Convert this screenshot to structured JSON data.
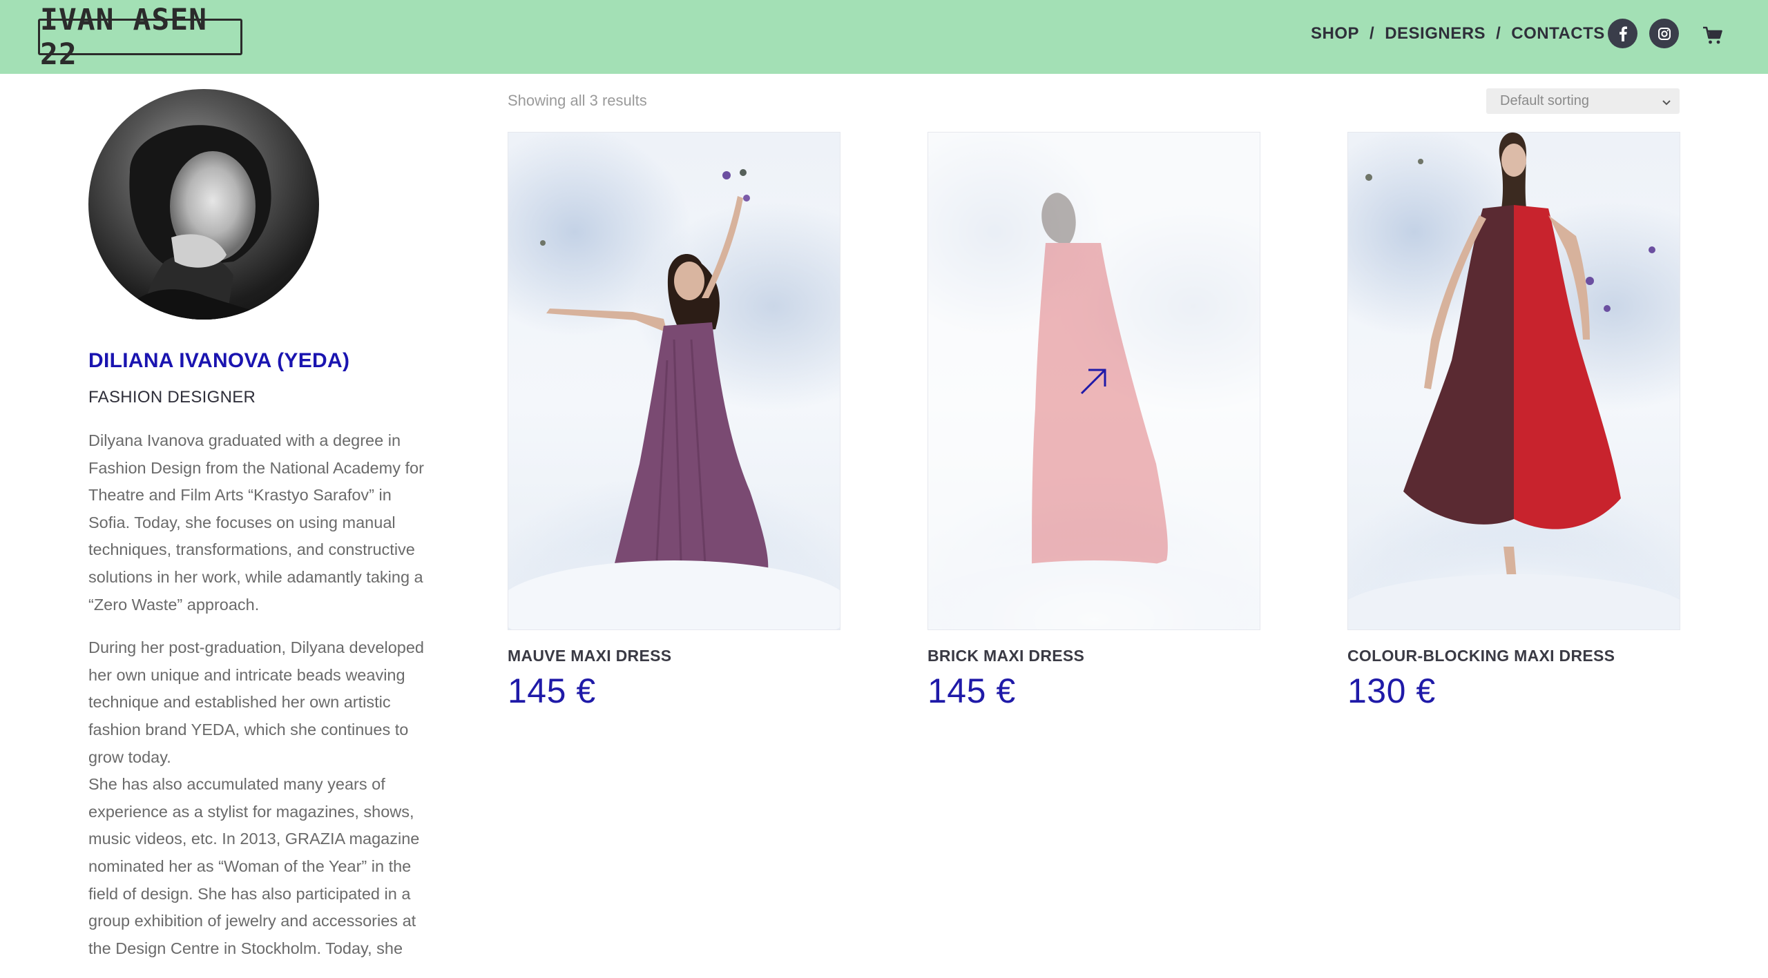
{
  "header": {
    "logo_text": "IVAN ASEN 22",
    "nav": [
      "SHOP",
      "DESIGNERS",
      "CONTACTS"
    ],
    "separator": "/",
    "social": [
      "facebook-icon",
      "instagram-icon"
    ],
    "cart_icon": "cart-icon",
    "bg_color": "#a3e0b5"
  },
  "designer": {
    "name": "DILIANA IVANOVA (YEDA)",
    "role": "FASHION DESIGNER",
    "bio": [
      "Dilyana Ivanova graduated with a degree in Fashion Design from the National Academy for Theatre and Film Arts “Krastyo Sarafov” in Sofia. Today, she focuses on using manual techniques, transformations, and constructive solutions in her work, while adamantly taking a “Zero Waste” approach.",
      "During her post-graduation, Dilyana developed her own unique and intricate beads weaving technique and established her own artistic fashion brand YEDA, which she continues to grow today.",
      "She has also accumulated many years of experience as a stylist for magazines, shows, music videos, etc. In 2013, GRAZIA magazine nominated her as “Woman of the Year” in the field of design. She has also participated in a group exhibition of jewelry and accessories at the Design Centre in Stockholm. Today, she"
    ]
  },
  "shop": {
    "results_text": "Showing all 3 results",
    "sorting_selected": "Default sorting",
    "products": [
      {
        "title": "MAUVE MAXI DRESS",
        "price": "145 €",
        "dress_color": "#7a4a72"
      },
      {
        "title": "BRICK MAXI DRESS",
        "price": "145 €",
        "dress_color": "#d5353b"
      },
      {
        "title": "COLOUR-BLOCKING MAXI DRESS",
        "price": "130 €",
        "dress_color": "#c8232d"
      }
    ],
    "accent_color": "#1f1aa8"
  }
}
